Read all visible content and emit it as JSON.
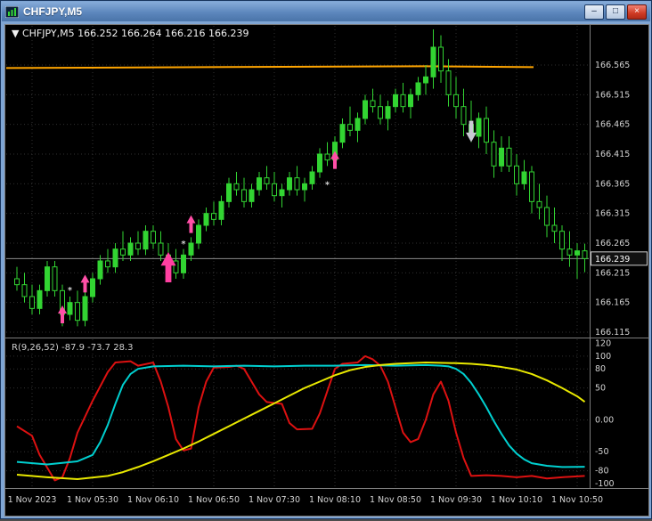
{
  "window": {
    "title": "CHFJPY,M5",
    "controls": {
      "minimize": "–",
      "maximize": "□",
      "close": "×"
    }
  },
  "chart": {
    "info": {
      "collapse_icon": "▼",
      "symbol": "CHFJPY,M5",
      "open": "166.252",
      "high": "166.264",
      "low": "166.216",
      "close": "166.239"
    },
    "price_axis": {
      "labels": [
        "166.565",
        "166.515",
        "166.465",
        "166.415",
        "166.365",
        "166.315",
        "166.265",
        "166.215",
        "166.165",
        "166.115"
      ],
      "current_price": "166.239"
    },
    "time_axis": {
      "labels": [
        "1 Nov 2023",
        "1 Nov 05:30",
        "1 Nov 06:10",
        "1 Nov 06:50",
        "1 Nov 07:30",
        "1 Nov 08:10",
        "1 Nov 08:50",
        "1 Nov 09:30",
        "1 Nov 10:10",
        "1 Nov 10:50"
      ],
      "indices": [
        2,
        10,
        18,
        26,
        34,
        42,
        50,
        58,
        66,
        74
      ]
    },
    "colors": {
      "background": "#000000",
      "grid": "#303030",
      "candle": "#32d432",
      "orange_line": "#ffa500",
      "bid_line": "#8a8a8a",
      "axis_text": "#d4d4d4",
      "border": "#7d7d7d",
      "arrow_up": "#ff4fa7",
      "arrow_down": "#c9c9d4",
      "ind_red": "#dd1111",
      "ind_cyan": "#00cfcf",
      "ind_yellow": "#e8e800"
    },
    "orange_line_price": 166.563,
    "bid_price": 166.239
  },
  "indicator": {
    "name": "R(9,26,52)",
    "values": [
      "-87.9",
      "-73.7",
      "28.3"
    ],
    "axis_labels": [
      "120",
      "100",
      "80",
      "50",
      "0.00",
      "-50",
      "-80",
      "-100"
    ],
    "grid_levels": [
      100,
      80,
      50,
      0,
      -50,
      -80
    ]
  },
  "chart_data": {
    "type": "candlestick",
    "symbol": "CHFJPY",
    "timeframe": "M5",
    "title": "CHFJPY,M5",
    "price_range": [
      166.115,
      166.565
    ],
    "ohlc_current": {
      "open": 166.252,
      "high": 166.264,
      "low": 166.216,
      "close": 166.239
    },
    "candles": [
      [
        "04:40",
        166.205,
        166.225,
        166.185,
        166.195
      ],
      [
        "04:45",
        166.195,
        166.215,
        166.165,
        166.175
      ],
      [
        "04:50",
        166.175,
        166.195,
        166.145,
        166.155
      ],
      [
        "04:55",
        166.155,
        166.195,
        166.145,
        166.185
      ],
      [
        "05:00",
        166.185,
        166.235,
        166.175,
        166.225
      ],
      [
        "05:05",
        166.225,
        166.235,
        166.175,
        166.185
      ],
      [
        "05:10",
        166.185,
        166.195,
        166.125,
        166.145
      ],
      [
        "05:15",
        166.145,
        166.175,
        166.135,
        166.165
      ],
      [
        "05:20",
        166.165,
        166.185,
        166.125,
        166.135
      ],
      [
        "05:25",
        166.135,
        166.185,
        166.125,
        166.175
      ],
      [
        "05:30",
        166.175,
        166.215,
        166.165,
        166.205
      ],
      [
        "05:35",
        166.205,
        166.245,
        166.195,
        166.235
      ],
      [
        "05:40",
        166.235,
        166.255,
        166.215,
        166.225
      ],
      [
        "05:45",
        166.225,
        166.265,
        166.215,
        166.255
      ],
      [
        "05:50",
        166.255,
        166.285,
        166.235,
        166.245
      ],
      [
        "05:55",
        166.245,
        166.275,
        166.235,
        166.265
      ],
      [
        "06:00",
        166.265,
        166.285,
        166.245,
        166.255
      ],
      [
        "06:05",
        166.255,
        166.295,
        166.245,
        166.285
      ],
      [
        "06:10",
        166.285,
        166.295,
        166.255,
        166.265
      ],
      [
        "06:15",
        166.265,
        166.285,
        166.235,
        166.245
      ],
      [
        "06:20",
        166.245,
        166.265,
        166.225,
        166.235
      ],
      [
        "06:25",
        166.235,
        166.255,
        166.205,
        166.215
      ],
      [
        "06:30",
        166.215,
        166.255,
        166.205,
        166.245
      ],
      [
        "06:35",
        166.245,
        166.275,
        166.235,
        166.265
      ],
      [
        "06:40",
        166.265,
        166.305,
        166.255,
        166.295
      ],
      [
        "06:45",
        166.295,
        166.325,
        166.285,
        166.315
      ],
      [
        "06:50",
        166.315,
        166.335,
        166.295,
        166.305
      ],
      [
        "06:55",
        166.305,
        166.345,
        166.295,
        166.335
      ],
      [
        "07:00",
        166.335,
        166.375,
        166.325,
        166.365
      ],
      [
        "07:05",
        166.365,
        166.385,
        166.345,
        166.355
      ],
      [
        "07:10",
        166.355,
        166.375,
        166.325,
        166.335
      ],
      [
        "07:15",
        166.335,
        166.365,
        166.325,
        166.355
      ],
      [
        "07:20",
        166.355,
        166.385,
        166.345,
        166.375
      ],
      [
        "07:25",
        166.375,
        166.395,
        166.355,
        166.365
      ],
      [
        "07:30",
        166.365,
        166.385,
        166.335,
        166.345
      ],
      [
        "07:35",
        166.345,
        166.365,
        166.325,
        166.355
      ],
      [
        "07:40",
        166.355,
        166.385,
        166.345,
        166.375
      ],
      [
        "07:45",
        166.375,
        166.395,
        166.345,
        166.355
      ],
      [
        "07:50",
        166.355,
        166.375,
        166.335,
        166.365
      ],
      [
        "07:55",
        166.365,
        166.395,
        166.355,
        166.385
      ],
      [
        "08:00",
        166.385,
        166.425,
        166.375,
        166.415
      ],
      [
        "08:05",
        166.415,
        166.435,
        166.395,
        166.405
      ],
      [
        "08:10",
        166.405,
        166.445,
        166.395,
        166.435
      ],
      [
        "08:15",
        166.435,
        166.475,
        166.425,
        166.465
      ],
      [
        "08:20",
        166.465,
        166.495,
        166.445,
        166.455
      ],
      [
        "08:25",
        166.455,
        166.485,
        166.435,
        166.475
      ],
      [
        "08:30",
        166.475,
        166.515,
        166.465,
        166.505
      ],
      [
        "08:35",
        166.505,
        166.525,
        166.485,
        166.495
      ],
      [
        "08:40",
        166.495,
        166.515,
        166.465,
        166.475
      ],
      [
        "08:45",
        166.475,
        166.505,
        166.455,
        166.495
      ],
      [
        "08:50",
        166.495,
        166.525,
        166.485,
        166.515
      ],
      [
        "08:55",
        166.515,
        166.535,
        166.485,
        166.495
      ],
      [
        "09:00",
        166.495,
        166.525,
        166.475,
        166.515
      ],
      [
        "09:05",
        166.515,
        166.545,
        166.505,
        166.535
      ],
      [
        "09:10",
        166.535,
        166.565,
        166.515,
        166.545
      ],
      [
        "09:15",
        166.545,
        166.625,
        166.525,
        166.595
      ],
      [
        "09:20",
        166.595,
        166.615,
        166.535,
        166.555
      ],
      [
        "09:25",
        166.555,
        166.575,
        166.495,
        166.515
      ],
      [
        "09:30",
        166.515,
        166.545,
        166.475,
        166.495
      ],
      [
        "09:35",
        166.495,
        166.525,
        166.445,
        166.465
      ],
      [
        "09:40",
        166.465,
        166.505,
        166.435,
        166.445
      ],
      [
        "09:45",
        166.445,
        166.485,
        166.425,
        166.475
      ],
      [
        "09:50",
        166.475,
        166.495,
        166.415,
        166.435
      ],
      [
        "09:55",
        166.435,
        166.455,
        166.375,
        166.395
      ],
      [
        "10:00",
        166.395,
        166.445,
        166.385,
        166.425
      ],
      [
        "10:05",
        166.425,
        166.445,
        166.385,
        166.395
      ],
      [
        "10:10",
        166.395,
        166.415,
        166.345,
        166.365
      ],
      [
        "10:15",
        166.365,
        166.405,
        166.355,
        166.385
      ],
      [
        "10:20",
        166.385,
        166.395,
        166.315,
        166.335
      ],
      [
        "10:25",
        166.335,
        166.365,
        166.305,
        166.325
      ],
      [
        "10:30",
        166.325,
        166.345,
        166.275,
        166.295
      ],
      [
        "10:35",
        166.295,
        166.325,
        166.265,
        166.285
      ],
      [
        "10:40",
        166.285,
        166.295,
        166.235,
        166.255
      ],
      [
        "10:45",
        166.255,
        166.285,
        166.225,
        166.245
      ],
      [
        "10:50",
        166.245,
        166.265,
        166.205,
        166.252
      ],
      [
        "10:55",
        166.252,
        166.264,
        166.216,
        166.239
      ]
    ],
    "oscillator": {
      "name": "R(9,26,52)",
      "range": [
        -100,
        120
      ],
      "series": [
        {
          "name": "red",
          "color": "#dd1111",
          "points": [
            [
              0,
              -10
            ],
            [
              2,
              -25
            ],
            [
              3,
              -55
            ],
            [
              5,
              -95
            ],
            [
              6,
              -90
            ],
            [
              7,
              -60
            ],
            [
              8,
              -20
            ],
            [
              10,
              30
            ],
            [
              12,
              75
            ],
            [
              13,
              90
            ],
            [
              15,
              92
            ],
            [
              16,
              85
            ],
            [
              18,
              90
            ],
            [
              19,
              60
            ],
            [
              20,
              20
            ],
            [
              21,
              -30
            ],
            [
              22,
              -48
            ],
            [
              23,
              -45
            ],
            [
              24,
              20
            ],
            [
              25,
              60
            ],
            [
              26,
              82
            ],
            [
              28,
              83
            ],
            [
              29,
              85
            ],
            [
              30,
              80
            ],
            [
              31,
              60
            ],
            [
              32,
              40
            ],
            [
              33,
              28
            ],
            [
              35,
              25
            ],
            [
              36,
              -5
            ],
            [
              37,
              -15
            ],
            [
              39,
              -14
            ],
            [
              40,
              10
            ],
            [
              41,
              45
            ],
            [
              42,
              80
            ],
            [
              43,
              88
            ],
            [
              45,
              90
            ],
            [
              46,
              100
            ],
            [
              47,
              95
            ],
            [
              48,
              85
            ],
            [
              49,
              60
            ],
            [
              50,
              20
            ],
            [
              51,
              -20
            ],
            [
              52,
              -35
            ],
            [
              53,
              -30
            ],
            [
              54,
              0
            ],
            [
              55,
              40
            ],
            [
              56,
              60
            ],
            [
              57,
              30
            ],
            [
              58,
              -20
            ],
            [
              59,
              -60
            ],
            [
              60,
              -88
            ],
            [
              62,
              -87
            ],
            [
              64,
              -88
            ],
            [
              66,
              -90
            ],
            [
              68,
              -88
            ],
            [
              70,
              -92
            ],
            [
              72,
              -90
            ],
            [
              75,
              -87.9
            ]
          ]
        },
        {
          "name": "cyan",
          "color": "#00cfcf",
          "points": [
            [
              0,
              -66
            ],
            [
              4,
              -70
            ],
            [
              8,
              -65
            ],
            [
              10,
              -55
            ],
            [
              11,
              -35
            ],
            [
              12,
              -8
            ],
            [
              13,
              25
            ],
            [
              14,
              55
            ],
            [
              15,
              72
            ],
            [
              16,
              80
            ],
            [
              18,
              84
            ],
            [
              22,
              85
            ],
            [
              26,
              84
            ],
            [
              30,
              85
            ],
            [
              34,
              84
            ],
            [
              38,
              85
            ],
            [
              42,
              85
            ],
            [
              46,
              86
            ],
            [
              50,
              85
            ],
            [
              54,
              86
            ],
            [
              56,
              85
            ],
            [
              57,
              84
            ],
            [
              58,
              80
            ],
            [
              59,
              72
            ],
            [
              60,
              58
            ],
            [
              61,
              40
            ],
            [
              62,
              20
            ],
            [
              63,
              -2
            ],
            [
              64,
              -22
            ],
            [
              65,
              -40
            ],
            [
              66,
              -53
            ],
            [
              67,
              -62
            ],
            [
              68,
              -68
            ],
            [
              70,
              -72
            ],
            [
              72,
              -74
            ],
            [
              75,
              -73.7
            ]
          ]
        },
        {
          "name": "yellow",
          "color": "#e8e800",
          "points": [
            [
              0,
              -86
            ],
            [
              4,
              -90
            ],
            [
              8,
              -93
            ],
            [
              12,
              -88
            ],
            [
              14,
              -82
            ],
            [
              16,
              -74
            ],
            [
              18,
              -65
            ],
            [
              20,
              -55
            ],
            [
              22,
              -45
            ],
            [
              24,
              -34
            ],
            [
              26,
              -22
            ],
            [
              28,
              -10
            ],
            [
              30,
              2
            ],
            [
              32,
              14
            ],
            [
              34,
              26
            ],
            [
              36,
              38
            ],
            [
              38,
              50
            ],
            [
              40,
              60
            ],
            [
              42,
              70
            ],
            [
              44,
              78
            ],
            [
              46,
              83
            ],
            [
              48,
              86
            ],
            [
              50,
              88
            ],
            [
              52,
              89
            ],
            [
              54,
              90
            ],
            [
              58,
              89
            ],
            [
              60,
              88
            ],
            [
              62,
              86
            ],
            [
              64,
              83
            ],
            [
              66,
              79
            ],
            [
              68,
              72
            ],
            [
              70,
              62
            ],
            [
              72,
              50
            ],
            [
              74,
              37
            ],
            [
              75,
              28.3
            ]
          ]
        }
      ]
    },
    "markers": [
      {
        "i": 6,
        "price": 166.16,
        "kind": "arrow-up",
        "color": "#ff4fa7",
        "scale": 1
      },
      {
        "i": 7,
        "price": 166.19,
        "kind": "star",
        "color": "#ff4fa7"
      },
      {
        "i": 9,
        "price": 166.212,
        "kind": "arrow-up",
        "color": "#ff4fa7",
        "scale": 1
      },
      {
        "i": 20,
        "price": 166.25,
        "kind": "arrow-up",
        "color": "#ff3fa0",
        "scale": 1.7
      },
      {
        "i": 22,
        "price": 166.268,
        "kind": "star",
        "color": "#ff4fa7"
      },
      {
        "i": 23,
        "price": 166.312,
        "kind": "arrow-up",
        "color": "#ff4fa7",
        "scale": 1
      },
      {
        "i": 41,
        "price": 166.368,
        "kind": "star",
        "color": "#ff4fa7"
      },
      {
        "i": 42,
        "price": 166.42,
        "kind": "arrow-up",
        "color": "#ff4fa7",
        "scale": 1
      },
      {
        "i": 60,
        "price": 166.435,
        "kind": "arrow-down",
        "color": "#c9c9d4",
        "scale": 1.2
      }
    ]
  }
}
